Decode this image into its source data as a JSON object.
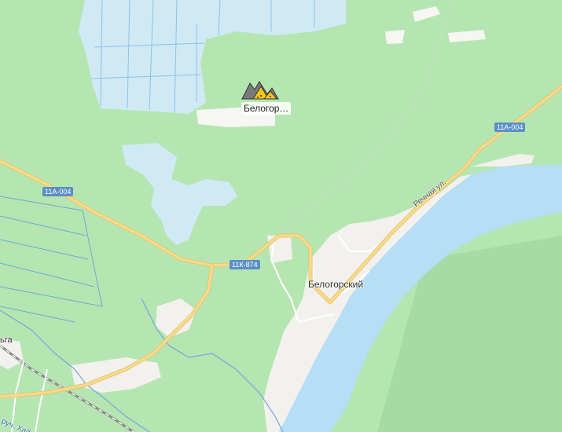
{
  "map": {
    "colors": {
      "forest": "#b5e6b1",
      "forest_dark": "#a6dba6",
      "meadow": "#c9ecc8",
      "water": "#b6def5",
      "water_deep": "#8cc3ec",
      "settlement": "#f3f1ee",
      "road_major": "#f7d98a",
      "road_minor": "#ffffff",
      "railway": "#8a8a8a",
      "stream": "#74a6da",
      "shield": "#5b8fc6",
      "poi": "#f5c518"
    },
    "road_labels": {
      "west": "11А-004",
      "east": "11А-004",
      "center": "11К-874"
    },
    "poi": {
      "label": "Белогор…",
      "icon": "mine-quarry-icon"
    },
    "places": {
      "town": "Белогорский",
      "street": "Речная ул.",
      "stream": "руч. Хайновский",
      "edge_label": "ьга"
    }
  }
}
